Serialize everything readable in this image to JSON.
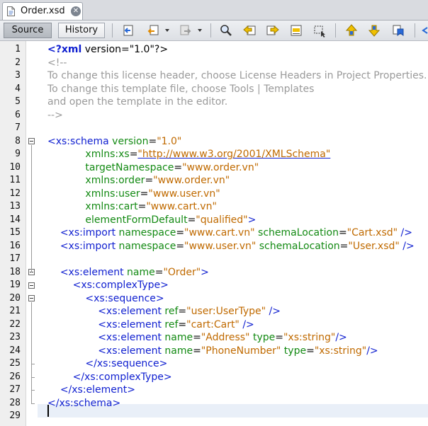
{
  "tab": {
    "title": "Order.xsd",
    "close": "✕"
  },
  "toolbar": {
    "source_label": "Source",
    "history_label": "History"
  },
  "lines": [
    [
      {
        "c": "pi",
        "t": "<?xml"
      },
      {
        "c": "txt",
        "t": " version=\"1.0\"?>"
      }
    ],
    [
      {
        "c": "com",
        "t": "<!--"
      }
    ],
    [
      {
        "c": "com",
        "t": "To change this license header, choose License Headers in Project Properties."
      }
    ],
    [
      {
        "c": "com",
        "t": "To change this template file, choose Tools | Templates"
      }
    ],
    [
      {
        "c": "com",
        "t": "and open the template in the editor."
      }
    ],
    [
      {
        "c": "com",
        "t": "-->"
      }
    ],
    [],
    [
      {
        "c": "tag",
        "t": "<xs:schema"
      },
      {
        "c": "attr",
        "t": " version"
      },
      {
        "c": "txt",
        "t": "="
      },
      {
        "c": "val",
        "t": "\"1.0\""
      }
    ],
    [
      {
        "c": "txt",
        "t": "            "
      },
      {
        "c": "attr",
        "t": "xmlns:xs"
      },
      {
        "c": "txt",
        "t": "="
      },
      {
        "c": "url",
        "t": "\"http://www.w3.org/2001/XMLSchema\""
      }
    ],
    [
      {
        "c": "txt",
        "t": "            "
      },
      {
        "c": "attr",
        "t": "targetNamespace"
      },
      {
        "c": "txt",
        "t": "="
      },
      {
        "c": "val",
        "t": "\"www.order.vn\""
      }
    ],
    [
      {
        "c": "txt",
        "t": "            "
      },
      {
        "c": "attr",
        "t": "xmlns:order"
      },
      {
        "c": "txt",
        "t": "="
      },
      {
        "c": "val",
        "t": "\"www.order.vn\""
      }
    ],
    [
      {
        "c": "txt",
        "t": "            "
      },
      {
        "c": "attr",
        "t": "xmlns:user"
      },
      {
        "c": "txt",
        "t": "="
      },
      {
        "c": "val",
        "t": "\"www.user.vn\""
      }
    ],
    [
      {
        "c": "txt",
        "t": "            "
      },
      {
        "c": "attr",
        "t": "xmlns:cart"
      },
      {
        "c": "txt",
        "t": "="
      },
      {
        "c": "val",
        "t": "\"www.cart.vn\""
      }
    ],
    [
      {
        "c": "txt",
        "t": "            "
      },
      {
        "c": "attr",
        "t": "elementFormDefault"
      },
      {
        "c": "txt",
        "t": "="
      },
      {
        "c": "val",
        "t": "\"qualified\""
      },
      {
        "c": "tag",
        "t": ">"
      }
    ],
    [
      {
        "c": "txt",
        "t": "    "
      },
      {
        "c": "tag",
        "t": "<xs:import"
      },
      {
        "c": "attr",
        "t": " namespace"
      },
      {
        "c": "txt",
        "t": "="
      },
      {
        "c": "val",
        "t": "\"www.cart.vn\""
      },
      {
        "c": "attr",
        "t": " schemaLocation"
      },
      {
        "c": "txt",
        "t": "="
      },
      {
        "c": "val",
        "t": "\"Cart.xsd\""
      },
      {
        "c": "tag",
        "t": " />"
      }
    ],
    [
      {
        "c": "txt",
        "t": "    "
      },
      {
        "c": "tag",
        "t": "<xs:import"
      },
      {
        "c": "attr",
        "t": " namespace"
      },
      {
        "c": "txt",
        "t": "="
      },
      {
        "c": "val",
        "t": "\"www.user.vn\""
      },
      {
        "c": "attr",
        "t": " schemaLocation"
      },
      {
        "c": "txt",
        "t": "="
      },
      {
        "c": "val",
        "t": "\"User.xsd\""
      },
      {
        "c": "tag",
        "t": " />"
      }
    ],
    [],
    [
      {
        "c": "txt",
        "t": "    "
      },
      {
        "c": "tag",
        "t": "<xs:element"
      },
      {
        "c": "attr",
        "t": " name"
      },
      {
        "c": "txt",
        "t": "="
      },
      {
        "c": "val",
        "t": "\"Order\""
      },
      {
        "c": "tag",
        "t": ">"
      }
    ],
    [
      {
        "c": "txt",
        "t": "        "
      },
      {
        "c": "tag",
        "t": "<xs:complexType>"
      }
    ],
    [
      {
        "c": "txt",
        "t": "            "
      },
      {
        "c": "tag",
        "t": "<xs:sequence>"
      }
    ],
    [
      {
        "c": "txt",
        "t": "                "
      },
      {
        "c": "tag",
        "t": "<xs:element"
      },
      {
        "c": "attr",
        "t": " ref"
      },
      {
        "c": "txt",
        "t": "="
      },
      {
        "c": "val",
        "t": "\"user:UserType\""
      },
      {
        "c": "tag",
        "t": " />"
      }
    ],
    [
      {
        "c": "txt",
        "t": "                "
      },
      {
        "c": "tag",
        "t": "<xs:element"
      },
      {
        "c": "attr",
        "t": " ref"
      },
      {
        "c": "txt",
        "t": "="
      },
      {
        "c": "val",
        "t": "\"cart:Cart\""
      },
      {
        "c": "tag",
        "t": " />"
      }
    ],
    [
      {
        "c": "txt",
        "t": "                "
      },
      {
        "c": "tag",
        "t": "<xs:element"
      },
      {
        "c": "attr",
        "t": " name"
      },
      {
        "c": "txt",
        "t": "="
      },
      {
        "c": "val",
        "t": "\"Address\""
      },
      {
        "c": "attr",
        "t": " type"
      },
      {
        "c": "txt",
        "t": "="
      },
      {
        "c": "val",
        "t": "\"xs:string\""
      },
      {
        "c": "tag",
        "t": "/>"
      }
    ],
    [
      {
        "c": "txt",
        "t": "                "
      },
      {
        "c": "tag",
        "t": "<xs:element"
      },
      {
        "c": "attr",
        "t": " name"
      },
      {
        "c": "txt",
        "t": "="
      },
      {
        "c": "val",
        "t": "\"PhoneNumber\""
      },
      {
        "c": "attr",
        "t": " type"
      },
      {
        "c": "txt",
        "t": "="
      },
      {
        "c": "val",
        "t": "\"xs:string\""
      },
      {
        "c": "tag",
        "t": "/>"
      }
    ],
    [
      {
        "c": "txt",
        "t": "            "
      },
      {
        "c": "tag",
        "t": "</xs:sequence>"
      }
    ],
    [
      {
        "c": "txt",
        "t": "        "
      },
      {
        "c": "tag",
        "t": "</xs:complexType>"
      }
    ],
    [
      {
        "c": "txt",
        "t": "    "
      },
      {
        "c": "tag",
        "t": "</xs:element>"
      }
    ],
    [
      {
        "c": "tag",
        "t": "</xs:schema>"
      }
    ],
    []
  ]
}
